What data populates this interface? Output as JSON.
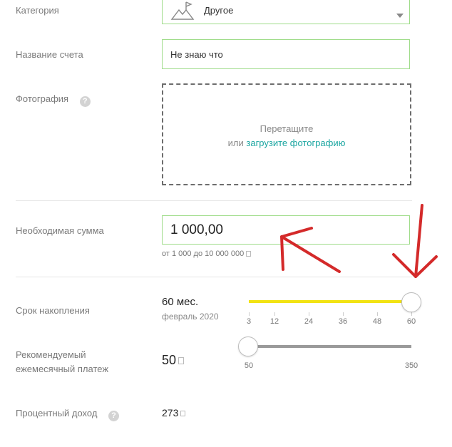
{
  "category": {
    "label": "Категория",
    "value": "Другое",
    "icon": "mountain-flag-icon"
  },
  "account_name": {
    "label": "Название счета",
    "value": "Не знаю что"
  },
  "photo": {
    "label": "Фотография",
    "help": "?",
    "drop_text": "Перетащите",
    "or_text": "или",
    "upload_link": "загрузите фотографию"
  },
  "amount": {
    "label": "Необходимая сумма",
    "value": "1 000,00",
    "range_hint": "от 1 000 до 10 000 000"
  },
  "term": {
    "label": "Срок накопления",
    "value": "60 мес.",
    "date": "февраль 2020",
    "ticks": [
      "3",
      "12",
      "24",
      "36",
      "48",
      "60"
    ],
    "slider_value": 60,
    "min": 3,
    "max": 60
  },
  "monthly": {
    "label_line1": "Рекомендуемый",
    "label_line2": "ежемесячный платеж",
    "value": "50",
    "ticks": [
      "50",
      "350"
    ],
    "slider_value": 50,
    "min": 50,
    "max": 350
  },
  "interest": {
    "label": "Процентный доход",
    "help": "?",
    "value": "273"
  },
  "colors": {
    "accent": "#19a5a0",
    "field_border": "#9fdc8a",
    "slider_fill": "#f2e313",
    "slider_track": "#9a9a9a",
    "arrow": "#d42a2a"
  }
}
